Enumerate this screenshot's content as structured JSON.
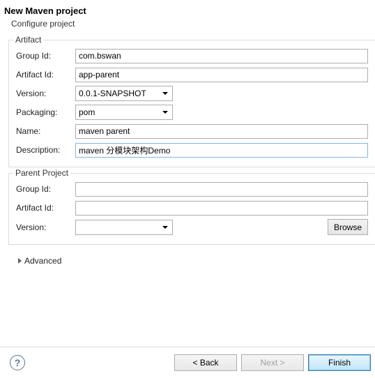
{
  "header": {
    "title": "New Maven project",
    "subtitle": "Configure project"
  },
  "artifact": {
    "legend": "Artifact",
    "groupId": {
      "label": "Group Id:",
      "value": "com.bswan"
    },
    "artifactId": {
      "label": "Artifact Id:",
      "value": "app-parent"
    },
    "version": {
      "label": "Version:",
      "value": "0.0.1-SNAPSHOT"
    },
    "packaging": {
      "label": "Packaging:",
      "value": "pom"
    },
    "name": {
      "label": "Name:",
      "value": "maven parent"
    },
    "description": {
      "label": "Description:",
      "value": "maven 分模块架构Demo"
    }
  },
  "parent": {
    "legend": "Parent Project",
    "groupId": {
      "label": "Group Id:",
      "value": ""
    },
    "artifactId": {
      "label": "Artifact Id:",
      "value": ""
    },
    "version": {
      "label": "Version:",
      "value": ""
    },
    "browse": "Browse"
  },
  "advanced": {
    "label": "Advanced"
  },
  "footer": {
    "help": "?",
    "back": "< Back",
    "next": "Next >",
    "finish": "Finish"
  }
}
